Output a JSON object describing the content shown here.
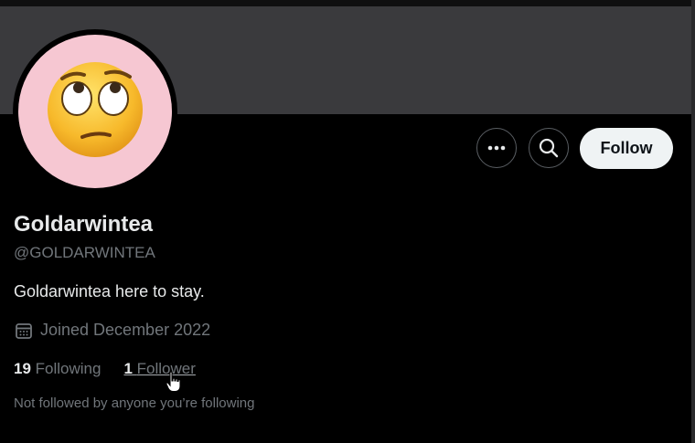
{
  "profile": {
    "display_name": "Goldarwintea",
    "handle": "@GOLDARWINTEA",
    "bio": "Goldarwintea here to stay.",
    "joined": "Joined December 2022",
    "avatar_icon": "eye-roll-emoji-icon",
    "avatar_bg": "#f6c7d2"
  },
  "actions": {
    "more_icon": "more-icon",
    "search_icon": "search-icon",
    "follow_label": "Follow"
  },
  "stats": {
    "following_count": "19",
    "following_label": "Following",
    "followers_count": "1",
    "followers_label": "Follower"
  },
  "footer_note": "Not followed by anyone you’re following",
  "colors": {
    "background": "#000000",
    "banner": "#3a3a3d",
    "text_primary": "#e7e9ea",
    "text_secondary": "#71767b",
    "follow_button_bg": "#eff3f4"
  }
}
